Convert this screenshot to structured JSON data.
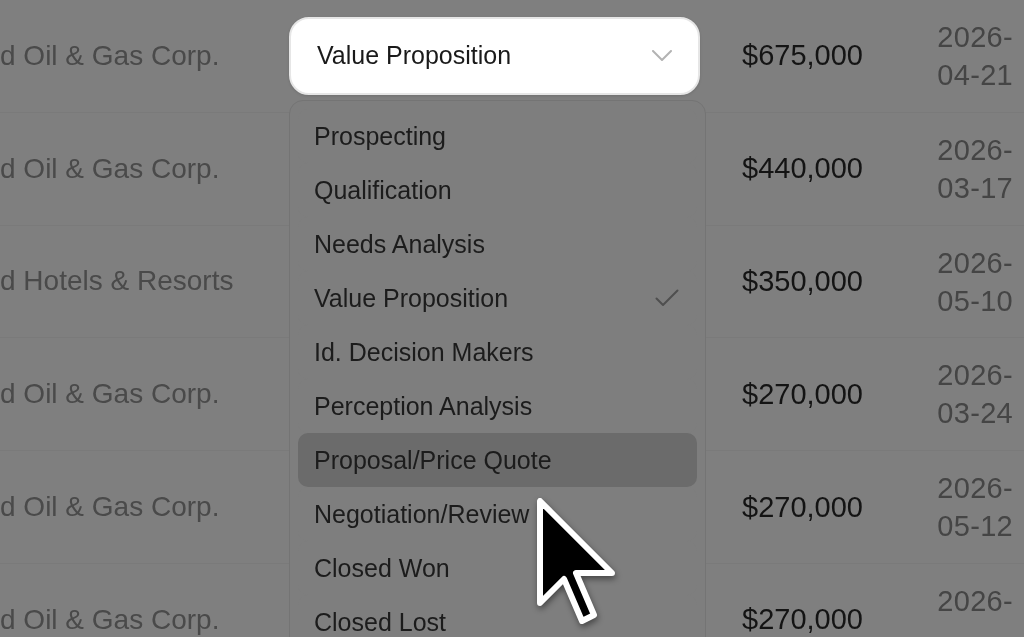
{
  "table": {
    "rows": [
      {
        "column_1": "d Oil & Gas Corp.",
        "column_2": {
          "value": "Value Proposition",
          "expanded": true,
          "options": [
            {
              "label": "Prospecting",
              "selected": false,
              "hovered": false
            },
            {
              "label": "Qualification",
              "selected": false,
              "hovered": false
            },
            {
              "label": "Needs Analysis",
              "selected": false,
              "hovered": false
            },
            {
              "label": "Value Proposition",
              "selected": true,
              "hovered": false
            },
            {
              "label": "Id. Decision Makers",
              "selected": false,
              "hovered": false
            },
            {
              "label": "Perception Analysis",
              "selected": false,
              "hovered": false
            },
            {
              "label": "Proposal/Price Quote",
              "selected": false,
              "hovered": true
            },
            {
              "label": "Negotiation/Review",
              "selected": false,
              "hovered": false
            },
            {
              "label": "Closed Won",
              "selected": false,
              "hovered": false
            },
            {
              "label": "Closed Lost",
              "selected": false,
              "hovered": false
            }
          ]
        },
        "column_3": "$675,000",
        "column_4": "2026-04-21"
      },
      {
        "column_1": "d Oil & Gas Corp.",
        "column_3": "$440,000",
        "column_4": "2026-03-17"
      },
      {
        "column_1": "d Hotels & Resorts",
        "column_3": "$350,000",
        "column_4": "2026-05-10"
      },
      {
        "column_1": "d Oil & Gas Corp.",
        "column_3": "$270,000",
        "column_4": "2026-03-24"
      },
      {
        "column_1": "d Oil & Gas Corp.",
        "column_3": "$270,000",
        "column_4": "2026-05-12"
      },
      {
        "column_1": "d Oil & Gas Corp.",
        "column_3": "$270,000",
        "column_4": "2026-"
      }
    ]
  }
}
